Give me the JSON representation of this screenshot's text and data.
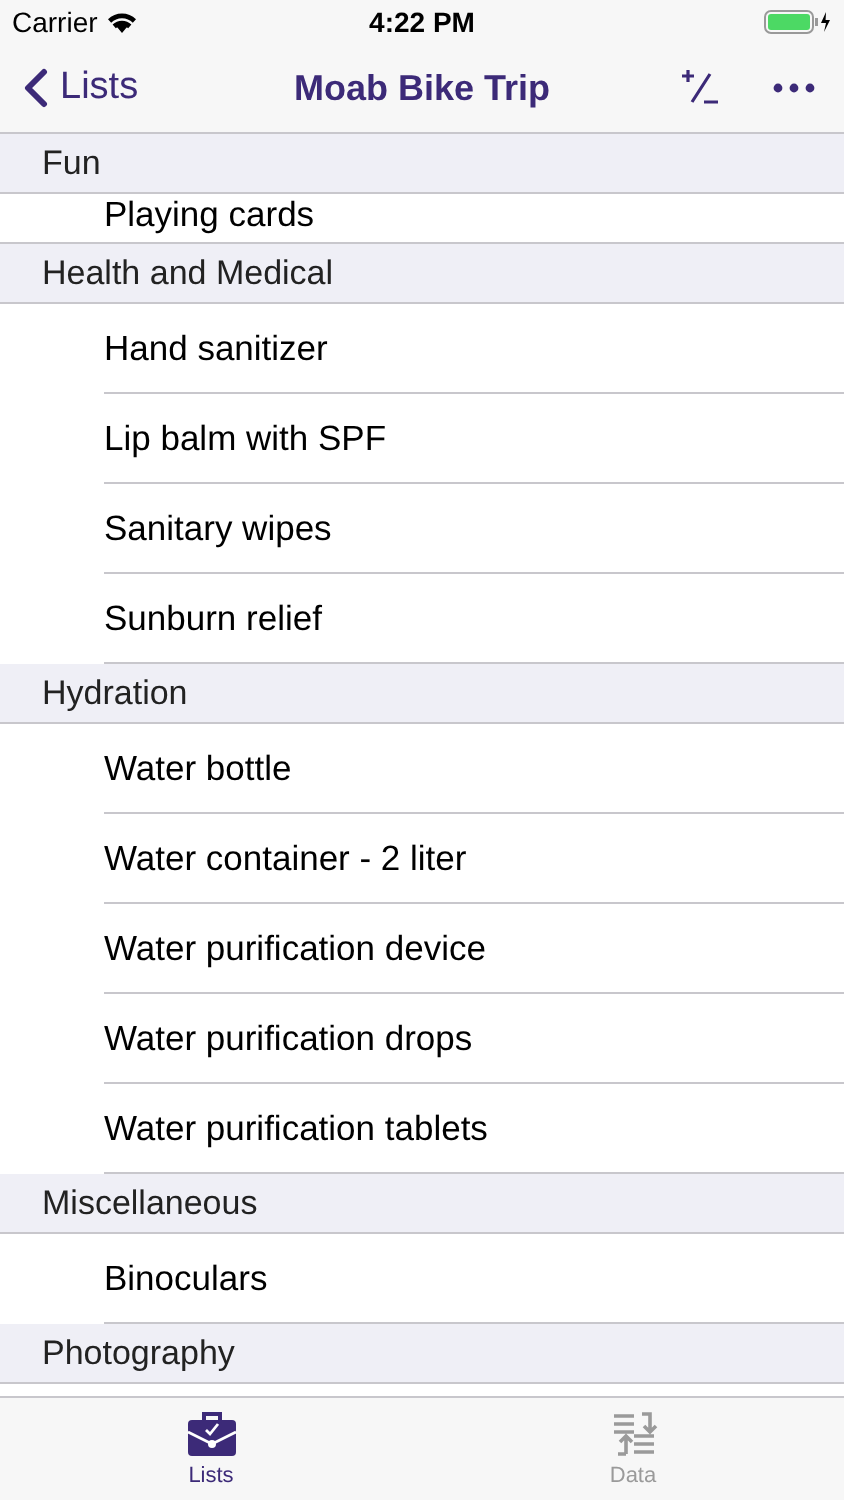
{
  "status_bar": {
    "carrier": "Carrier",
    "time": "4:22 PM"
  },
  "nav": {
    "back": "Lists",
    "title": "Moab Bike Trip"
  },
  "sections": [
    {
      "title": "Fun",
      "items": [
        "Playing cards"
      ]
    },
    {
      "title": "Health and Medical",
      "items": [
        "Hand sanitizer",
        "Lip balm with SPF",
        "Sanitary wipes",
        "Sunburn relief"
      ]
    },
    {
      "title": "Hydration",
      "items": [
        "Water bottle",
        "Water container - 2 liter",
        "Water purification device",
        "Water purification drops",
        "Water purification tablets"
      ]
    },
    {
      "title": "Miscellaneous",
      "items": [
        "Binoculars"
      ]
    },
    {
      "title": "Photography"
    }
  ],
  "tabs": [
    {
      "label": "Lists",
      "selected": true,
      "kind": "lists"
    },
    {
      "label": "Data",
      "selected": false,
      "kind": "data"
    }
  ]
}
